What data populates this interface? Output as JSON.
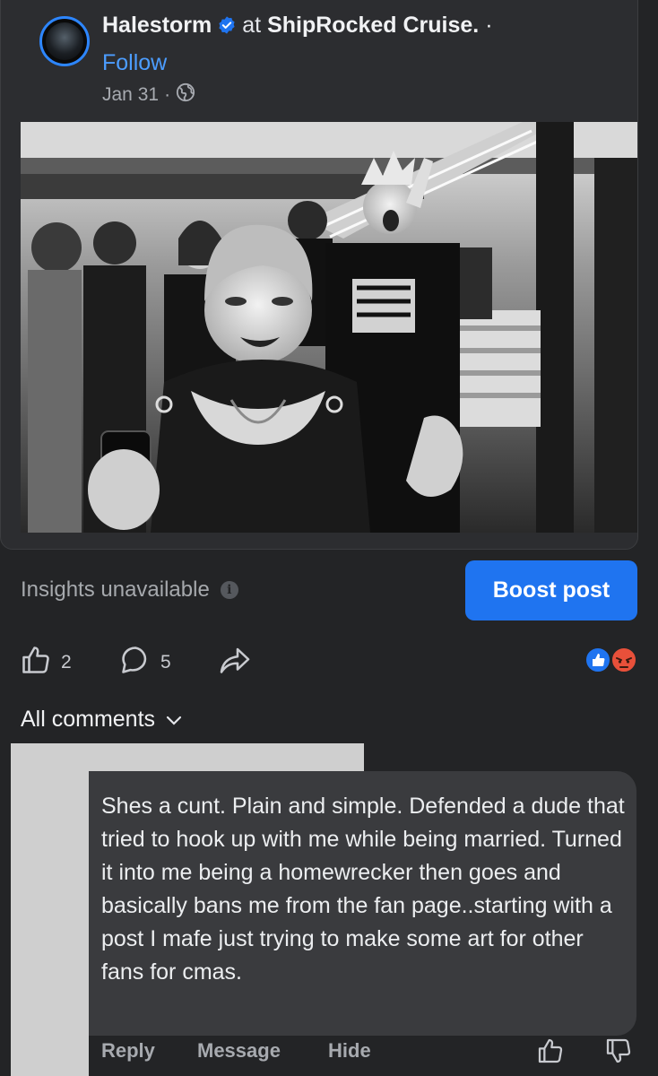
{
  "post": {
    "author": "Halestorm",
    "at_text": "at",
    "location": "ShipRocked Cruise.",
    "separator": "·",
    "follow_label": "Follow",
    "date": "Jan 31",
    "date_separator": "·",
    "privacy_icon": "globe-icon",
    "verified_icon": "verified-badge-icon"
  },
  "insights": {
    "label": "Insights unavailable",
    "info_icon": "info-icon",
    "info_glyph": "i"
  },
  "boost_label": "Boost post",
  "actions": {
    "like_count": "2",
    "comment_count": "5",
    "share_icon": "share-icon"
  },
  "reactions": [
    "like-reaction-icon",
    "angry-reaction-icon"
  ],
  "comments_header": "All comments",
  "comment": {
    "text": "Shes a cunt. Plain and simple. Defended a dude that tried to hook up with me while being married. Turned it into me being a homewrecker then goes and basically bans me from the fan page..starting with a post I mafe just trying to make some art for other fans for cmas.",
    "reply_label": "Reply",
    "message_label": "Message",
    "hide_label": "Hide"
  },
  "colors": {
    "background": "#232426",
    "card": "#2c2d30",
    "accent": "#1f74f0",
    "link": "#4c9dff",
    "comment_bubble": "#3a3b3e",
    "redaction": "#cfcfcf"
  }
}
